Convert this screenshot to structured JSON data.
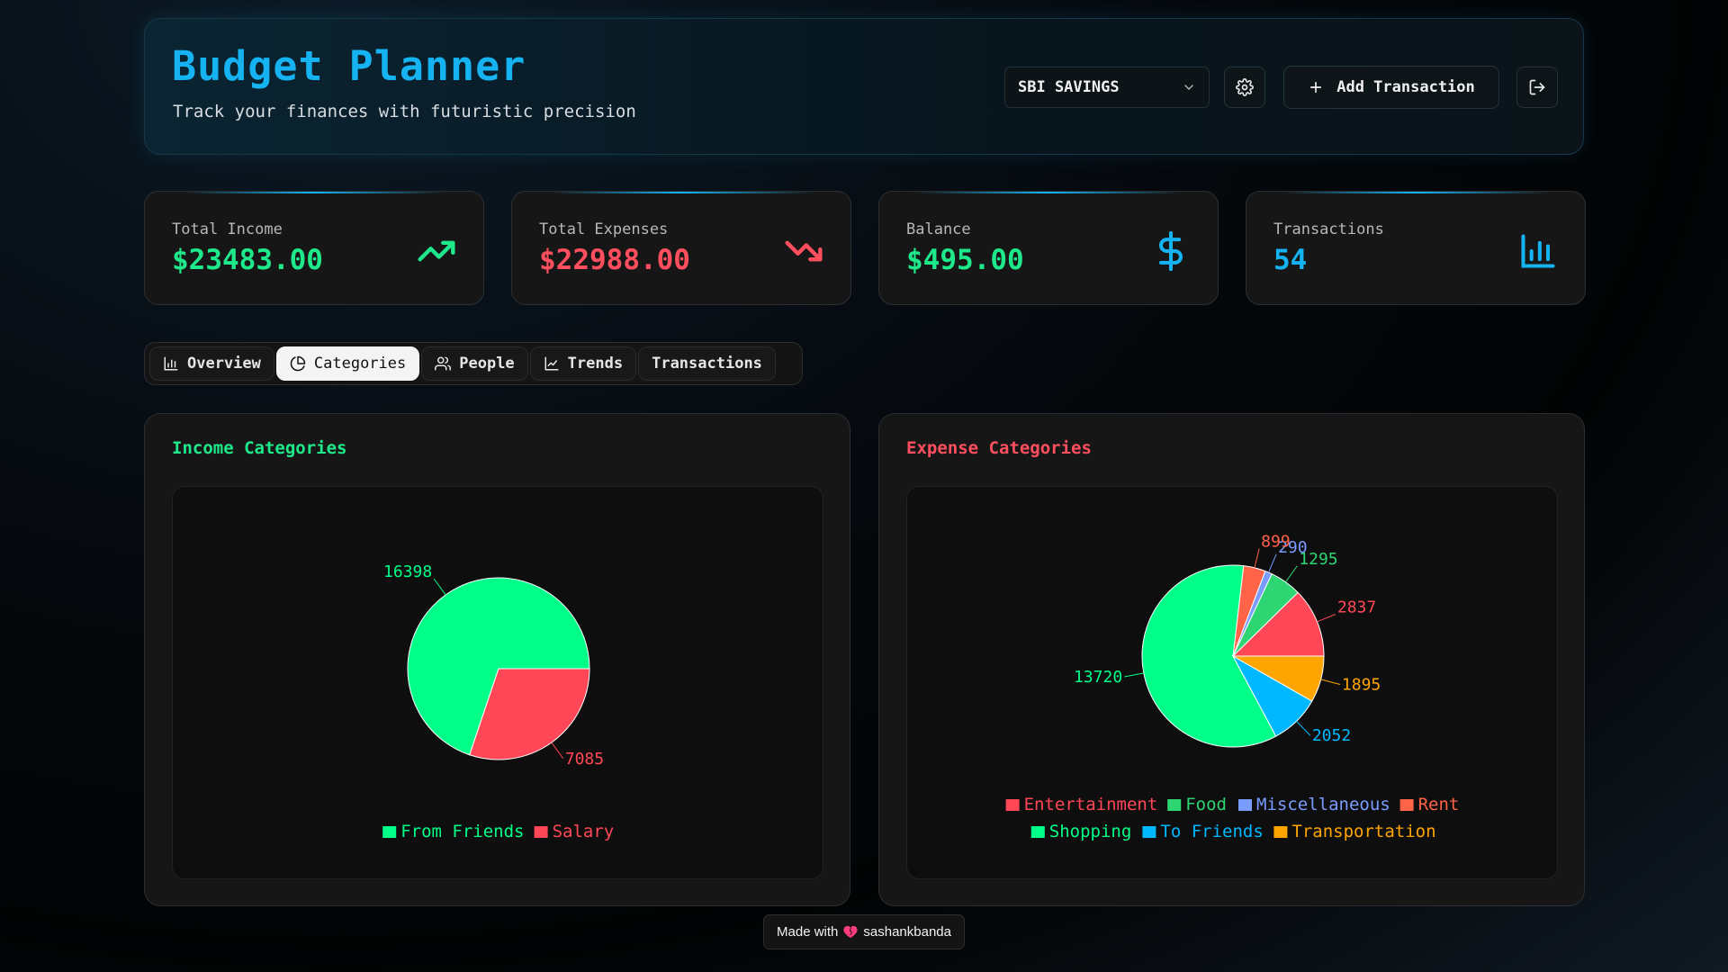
{
  "header": {
    "title": "Budget Planner",
    "subtitle": "Track your finances with futuristic precision",
    "account": "SBI SAVINGS",
    "add_label": "Add Transaction",
    "settings_icon": "gear-icon",
    "logout_icon": "log-out-icon"
  },
  "stats": [
    {
      "label": "Total Income",
      "value": "$23483.00",
      "color": "#1de98b",
      "icon": "trending-up-icon"
    },
    {
      "label": "Total Expenses",
      "value": "$22988.00",
      "color": "#ff4f5e",
      "icon": "trending-down-icon"
    },
    {
      "label": "Balance",
      "value": "$495.00",
      "color": "#1de98b",
      "icon": "dollar-icon"
    },
    {
      "label": "Transactions",
      "value": "54",
      "color": "#16b3f2",
      "icon": "bar-chart-icon"
    }
  ],
  "tabs": [
    {
      "label": "Overview",
      "icon": "bar-chart-icon"
    },
    {
      "label": "Categories",
      "icon": "pie-chart-icon",
      "active": true
    },
    {
      "label": "People",
      "icon": "users-icon"
    },
    {
      "label": "Trends",
      "icon": "line-chart-icon"
    },
    {
      "label": "Transactions",
      "icon": ""
    }
  ],
  "panels": {
    "income_title": "Income Categories",
    "expense_title": "Expense Categories"
  },
  "chart_data": [
    {
      "type": "pie",
      "title": "Income Categories",
      "categories": [
        "From Friends",
        "Salary"
      ],
      "values": [
        16398,
        7085
      ],
      "colors": [
        "#00ff88",
        "#ff4757"
      ],
      "legend": "bottom"
    },
    {
      "type": "pie",
      "title": "Expense Categories",
      "categories": [
        "Entertainment",
        "Food",
        "Miscellaneous",
        "Rent",
        "Shopping",
        "To Friends",
        "Transportation"
      ],
      "values": [
        2837,
        1295,
        290,
        899,
        13720,
        2052,
        1895
      ],
      "colors": [
        "#ff4757",
        "#2ed573",
        "#7b9cff",
        "#ff6348",
        "#00ff88",
        "#00b8ff",
        "#ffa502"
      ],
      "legend": "bottom"
    }
  ],
  "footer": {
    "text_before": "Made with",
    "text_after": "sashankbanda"
  }
}
